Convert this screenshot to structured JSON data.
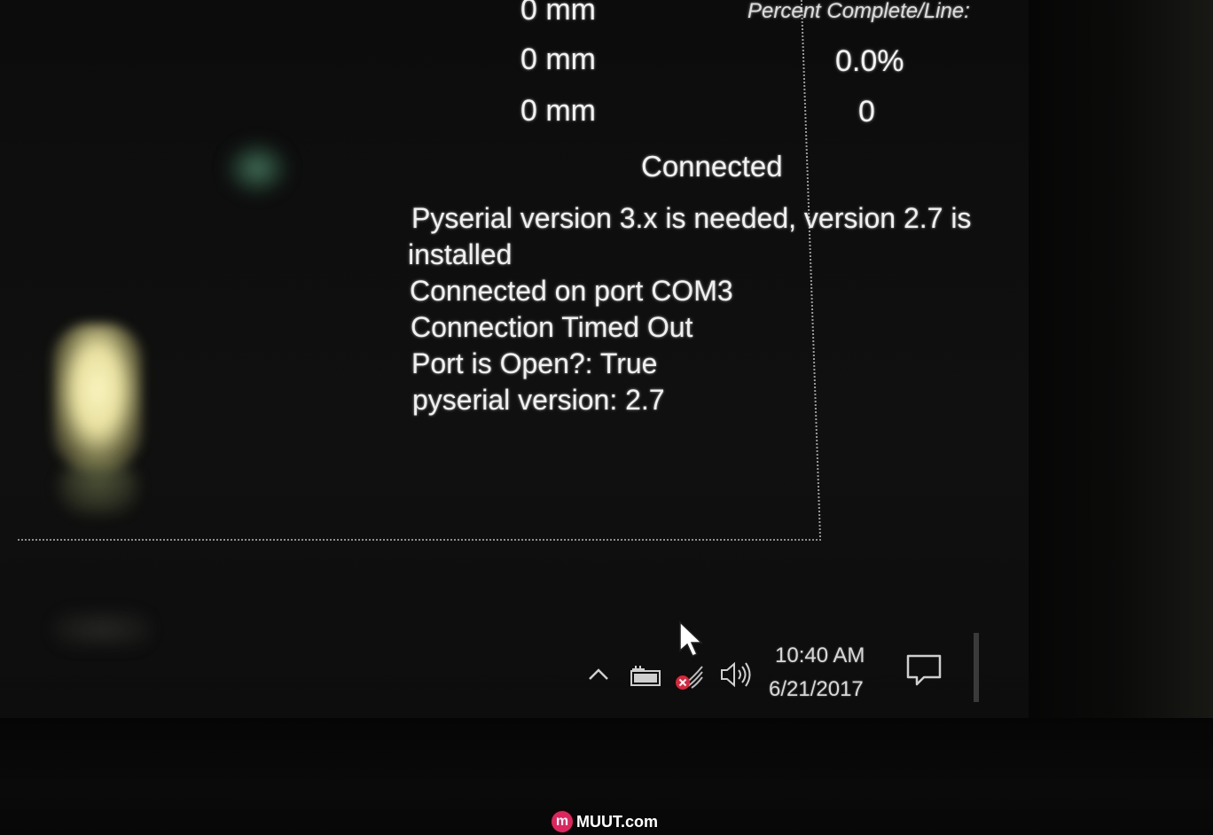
{
  "app_window": {
    "stat_header": "Percent Complete/Line:",
    "position_rows": [
      {
        "value": "0 mm"
      },
      {
        "value": "0 mm"
      },
      {
        "value": "0 mm"
      }
    ],
    "percent_complete": "0.0%",
    "line_number": "0",
    "connection_status": "Connected",
    "log_lines": [
      " Pyserial version 3.x is needed, version 2.7 is",
      "installed",
      "Connected on port COM3",
      "Connection Timed Out",
      "Port is Open?: True",
      "pyserial version: 2.7"
    ]
  },
  "taskbar": {
    "tray_icons": [
      "chevron-up-icon",
      "battery-icon",
      "wifi-disconnected-icon",
      "volume-icon"
    ],
    "clock_time": "10:40 AM",
    "clock_date": "6/21/2017",
    "notification_icon": "action-center-icon"
  },
  "watermark": {
    "logo_letter": "m",
    "text": "MUUT.com"
  },
  "colors": {
    "text": "#f2f2f2",
    "background": "#0c0c0c",
    "wifi_error": "#e0243a",
    "watermark_accent": "#e0245e"
  }
}
